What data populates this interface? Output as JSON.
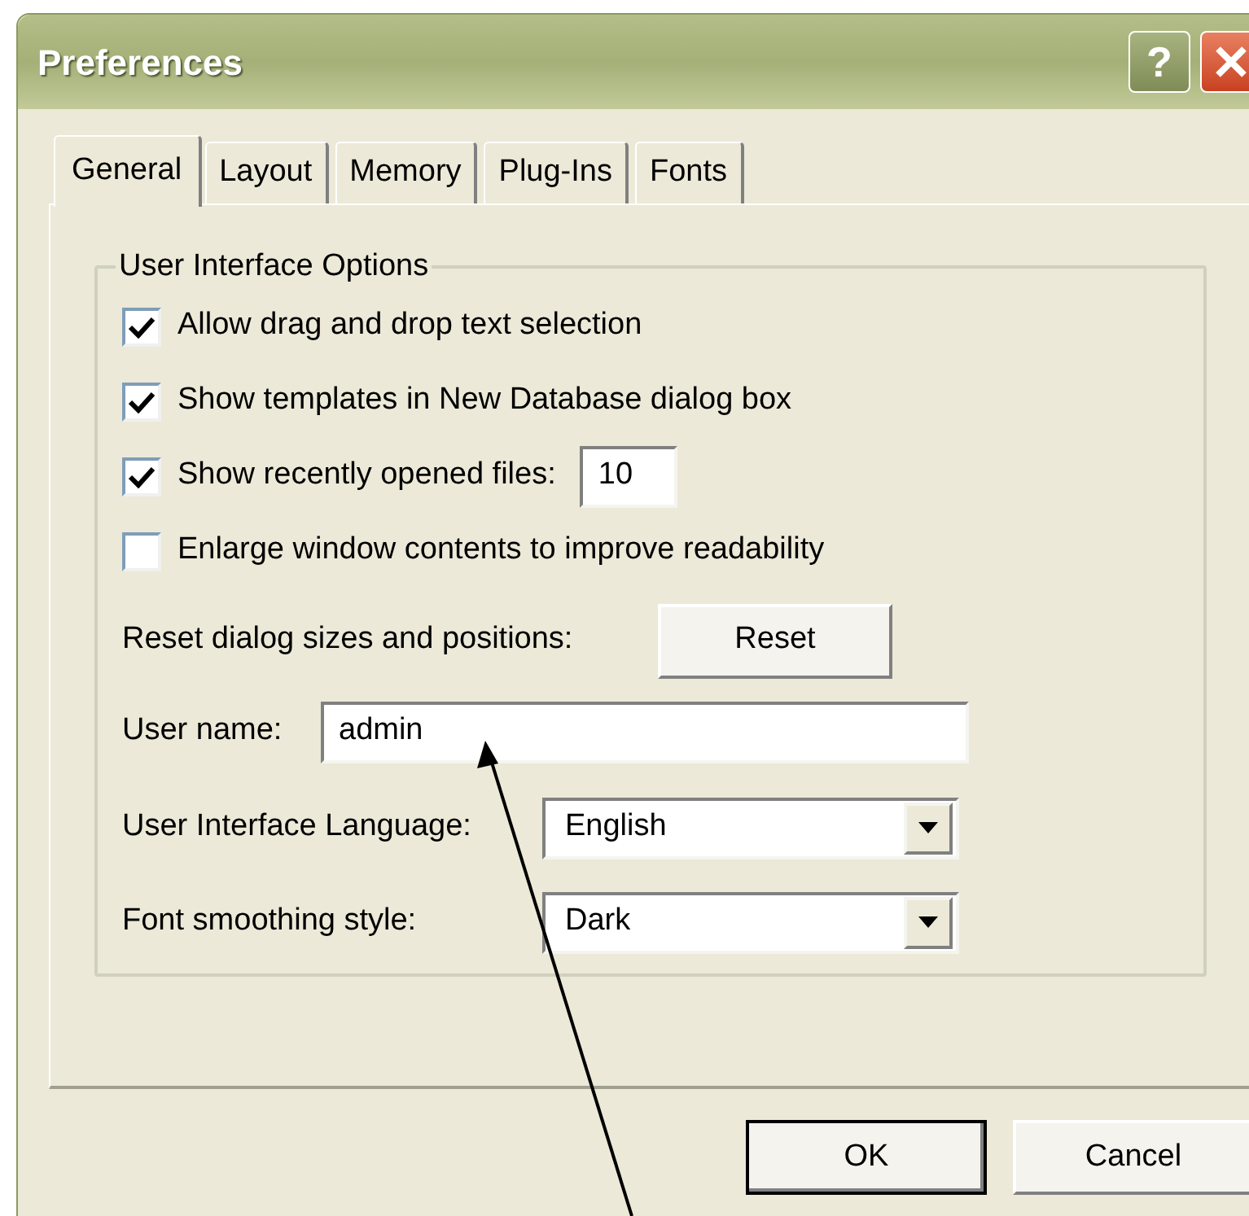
{
  "window": {
    "title": "Preferences",
    "help_label": "?"
  },
  "tabs": [
    {
      "label": "General",
      "selected": true
    },
    {
      "label": "Layout",
      "selected": false
    },
    {
      "label": "Memory",
      "selected": false
    },
    {
      "label": "Plug-Ins",
      "selected": false
    },
    {
      "label": "Fonts",
      "selected": false
    }
  ],
  "group": {
    "title": "User Interface Options",
    "options": [
      {
        "label": "Allow drag and drop text selection",
        "checked": true
      },
      {
        "label": "Show templates in New Database dialog box",
        "checked": true
      },
      {
        "label": "Show recently opened files:",
        "checked": true,
        "value": "10"
      },
      {
        "label": "Enlarge window contents to improve readability",
        "checked": false
      }
    ],
    "reset": {
      "label": "Reset dialog sizes and positions:",
      "button": "Reset"
    },
    "user_name": {
      "label": "User name:",
      "value": "admin"
    },
    "dropdowns": [
      {
        "label": "User Interface Language:",
        "value": "English"
      },
      {
        "label": "Font smoothing style:",
        "value": "Dark"
      }
    ]
  },
  "buttons": [
    {
      "label": "OK",
      "default": true
    },
    {
      "label": "Cancel",
      "default": false
    }
  ]
}
